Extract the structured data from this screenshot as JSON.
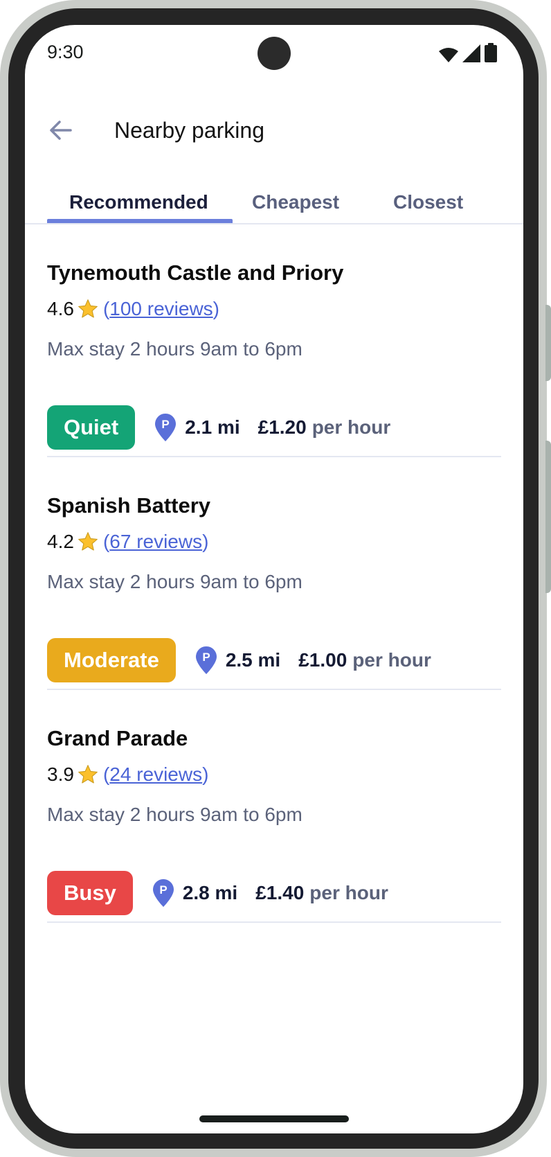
{
  "status_bar": {
    "time": "9:30",
    "icons": [
      "wifi-icon",
      "signal-icon",
      "battery-icon"
    ]
  },
  "app_bar": {
    "back_icon": "arrow-left-icon",
    "title": "Nearby parking"
  },
  "tabs": [
    {
      "label": "Recommended",
      "active": true
    },
    {
      "label": "Cheapest",
      "active": false
    },
    {
      "label": "Closest",
      "active": false
    }
  ],
  "colors": {
    "accent": "#6b7fdc",
    "link": "#4a63d6",
    "quiet": "#14a476",
    "moderate": "#e9aa1d",
    "busy": "#e84747",
    "pin": "#5a6fd9",
    "star": "#fbc02d"
  },
  "parking": [
    {
      "name": "Tynemouth Castle and Priory",
      "rating": "4.6",
      "reviews_open": "(",
      "reviews_text": "100 reviews",
      "reviews_close": ")",
      "max_stay": "Max stay 2 hours 9am to 6pm",
      "busyness": "Quiet",
      "busyness_level": "quiet",
      "distance": "2.1 mi",
      "price": "£1.20",
      "price_unit": "per hour"
    },
    {
      "name": "Spanish Battery",
      "rating": "4.2",
      "reviews_open": "(",
      "reviews_text": "67 reviews",
      "reviews_close": ")",
      "max_stay": "Max stay 2 hours 9am to 6pm",
      "busyness": "Moderate",
      "busyness_level": "moderate",
      "distance": "2.5 mi",
      "price": "£1.00",
      "price_unit": "per hour"
    },
    {
      "name": "Grand Parade",
      "rating": "3.9",
      "reviews_open": "(",
      "reviews_text": "24 reviews",
      "reviews_close": ")",
      "max_stay": "Max stay 2 hours 9am to 6pm",
      "busyness": "Busy",
      "busyness_level": "busy",
      "distance": "2.8 mi",
      "price": "£1.40",
      "price_unit": "per hour"
    }
  ],
  "pin_label": "P"
}
